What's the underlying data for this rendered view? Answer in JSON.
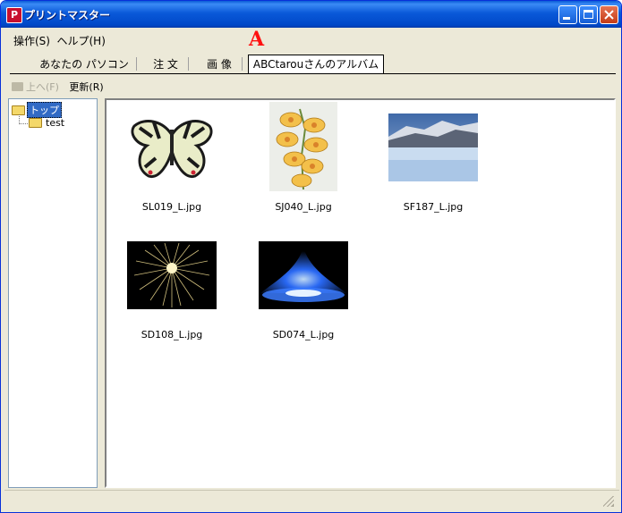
{
  "window": {
    "title": "プリントマスター"
  },
  "menu": [
    "操作(S)",
    "ヘルプ(H)"
  ],
  "annotation": "A",
  "tabs": [
    {
      "label": "あなたの パソコン",
      "active": false
    },
    {
      "label": "注 文",
      "active": false
    },
    {
      "label": "画 像",
      "active": false
    },
    {
      "label": "ABCtarouさんのアルバム",
      "active": true
    }
  ],
  "toolbar": {
    "up_label": "上へ(F)",
    "refresh_label": "更新(R)"
  },
  "tree": {
    "root": "トップ",
    "children": [
      "test"
    ]
  },
  "thumbnails": [
    {
      "name": "SL019_L.jpg",
      "subject": "butterfly"
    },
    {
      "name": "SJ040_L.jpg",
      "subject": "yellow-orchid"
    },
    {
      "name": "SF187_L.jpg",
      "subject": "snowy-landscape"
    },
    {
      "name": "SD108_L.jpg",
      "subject": "fireworks"
    },
    {
      "name": "SD074_L.jpg",
      "subject": "blue-flame"
    }
  ],
  "colors": {
    "titlebar": "#0a59d9",
    "tree_selection": "#316ac5",
    "annotation": "#ff1010"
  }
}
